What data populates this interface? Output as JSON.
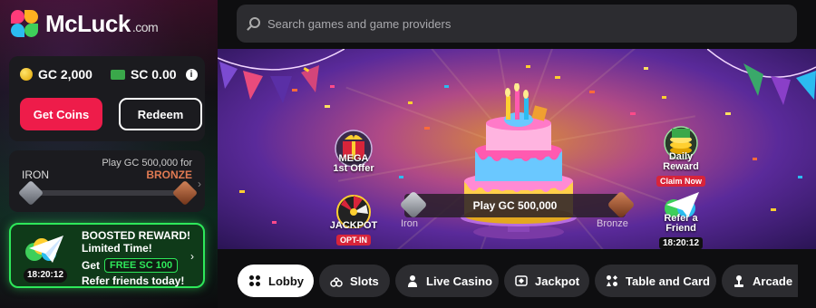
{
  "brand": {
    "name": "McLuck",
    "suffix": ".com"
  },
  "wallet": {
    "gc_label": "GC 2,000",
    "sc_label": "SC 0.00",
    "info_glyph": "i",
    "get_coins_label": "Get Coins",
    "redeem_label": "Redeem"
  },
  "tier": {
    "play_text": "Play GC 500,000 for",
    "current": "IRON",
    "next": "BRONZE",
    "progress": 0
  },
  "promo": {
    "title": "BOOSTED REWARD!",
    "subtitle": "Limited Time!",
    "get": "Get",
    "pill": "FREE SC 100",
    "footer": "Refer friends today!",
    "timer": "18:20:12"
  },
  "search": {
    "placeholder": "Search games and game providers"
  },
  "banner": {
    "mega_line1": "MEGA",
    "mega_line2": "1st Offer",
    "jackpot_line1": "JACKPOT",
    "jackpot_tag": "OPT-IN",
    "daily_line1": "Daily",
    "daily_line2": "Reward",
    "daily_tag": "Claim Now",
    "refer_line1": "Refer a",
    "refer_line2": "Friend",
    "refer_timer": "18:20:12",
    "play_text": "Play GC 500,000",
    "gem_left": "Iron",
    "gem_right": "Bronze"
  },
  "tabs": [
    {
      "label": "Lobby",
      "icon": "grid-icon",
      "active": true
    },
    {
      "label": "Slots",
      "icon": "cherry-icon",
      "active": false
    },
    {
      "label": "Live Casino",
      "icon": "dealer-icon",
      "active": false
    },
    {
      "label": "Jackpot",
      "icon": "jackpot-icon",
      "active": false
    },
    {
      "label": "Table and Card",
      "icon": "cards-icon",
      "active": false
    },
    {
      "label": "Arcade",
      "icon": "joystick-icon",
      "active": false
    }
  ],
  "colors": {
    "accent_red": "#ee1c4a",
    "promo_green": "#2ee85a",
    "bronze": "#e07a52"
  }
}
